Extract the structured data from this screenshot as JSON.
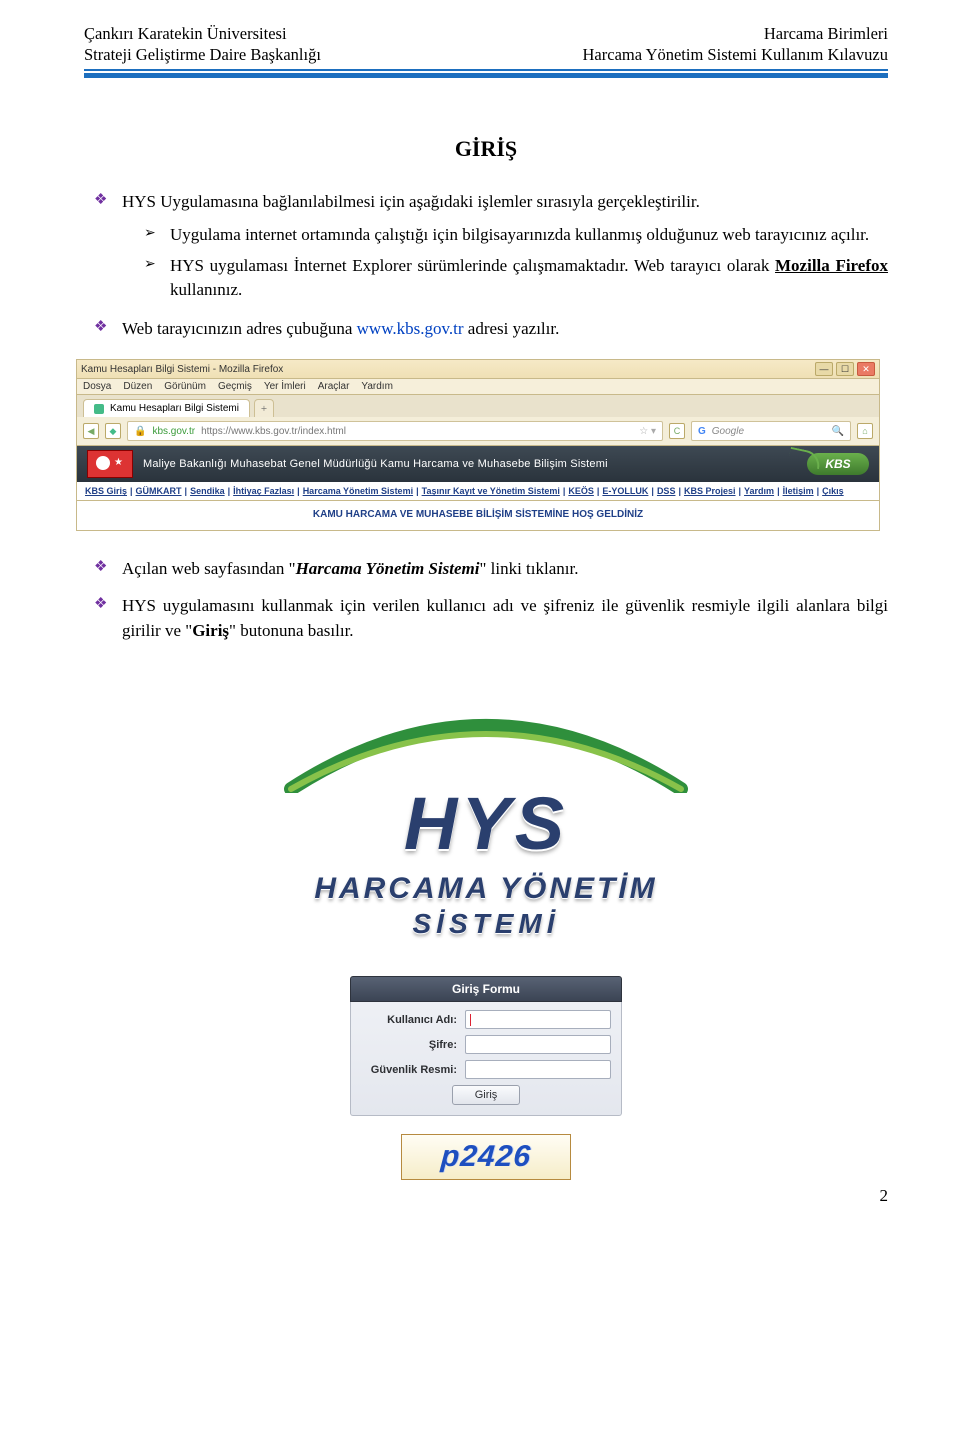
{
  "header": {
    "left_top": "Çankırı Karatekin Üniversitesi",
    "right_top": "Harcama Birimleri",
    "left_bot": "Strateji Geliştirme Daire Başkanlığı",
    "right_bot": "Harcama Yönetim Sistemi Kullanım Kılavuzu"
  },
  "title": "GİRİŞ",
  "bullets": {
    "b1": "HYS Uygulamasına bağlanılabilmesi için aşağıdaki işlemler sırasıyla gerçekleştirilir.",
    "b1a": "Uygulama internet ortamında çalıştığı için bilgisayarınızda kullanmış olduğunuz web tarayıcınız açılır.",
    "b1b_a": "HYS uygulaması İnternet Explorer sürümlerinde çalışmamaktadır. Web tarayıcı olarak ",
    "b1b_bold": "Mozilla Firefox",
    "b1b_c": " kullanınız.",
    "b2_a": "Web tarayıcınızın adres çubuğuna ",
    "b2_link": "www.kbs.gov.tr",
    "b2_b": " adresi yazılır.",
    "b3_a": "Açılan web sayfasından \"",
    "b3_bi": "Harcama Yönetim Sistemi",
    "b3_b": "\" linki tıklanır.",
    "b4_a": "HYS uygulamasını kullanmak için verilen kullanıcı adı ve şifreniz ile güvenlik resmiyle ilgili alanlara bilgi girilir ve \"",
    "b4_bold": "Giriş",
    "b4_b": "\" butonuna basılır."
  },
  "shot1": {
    "window_title": "Kamu Hesapları Bilgi Sistemi - Mozilla Firefox",
    "menus": [
      "Dosya",
      "Düzen",
      "Görünüm",
      "Geçmiş",
      "Yer İmleri",
      "Araçlar",
      "Yardım"
    ],
    "tab_title": "Kamu Hesapları Bilgi Sistemi",
    "url_host": "kbs.gov.tr",
    "url_full": "https://www.kbs.gov.tr/index.html",
    "search_placeholder": "Google",
    "search_right_icon": "🔍",
    "refresh": "C",
    "banner_text": "Maliye Bakanlığı Muhasebat Genel Müdürlüğü Kamu Harcama ve Muhasebe Bilişim Sistemi",
    "kbs_label": "KBS",
    "nav_links": [
      "KBS Giriş",
      "GÜMKART",
      "Sendika",
      "İhtiyaç Fazlası",
      "Harcama Yönetim Sistemi",
      "Taşınır Kayıt ve Yönetim Sistemi",
      "KEÖS",
      "E-YOLLUK",
      "DSS",
      "KBS Projesi",
      "Yardım",
      "İletişim",
      "Çıkış"
    ],
    "welcome": "KAMU HARCAMA VE MUHASEBE BİLİŞİM SİSTEMİNE HOŞ GELDİNİZ"
  },
  "logo": {
    "big": "HYS",
    "line1": "HARCAMA YÖNETİM",
    "line2": "SİSTEMİ"
  },
  "login": {
    "header": "Giriş Formu",
    "user_label": "Kullanıcı Adı:",
    "pass_label": "Şifre:",
    "captcha_label": "Güvenlik Resmi:",
    "button": "Giriş",
    "captcha_text": "p2426"
  },
  "page_number": "2"
}
